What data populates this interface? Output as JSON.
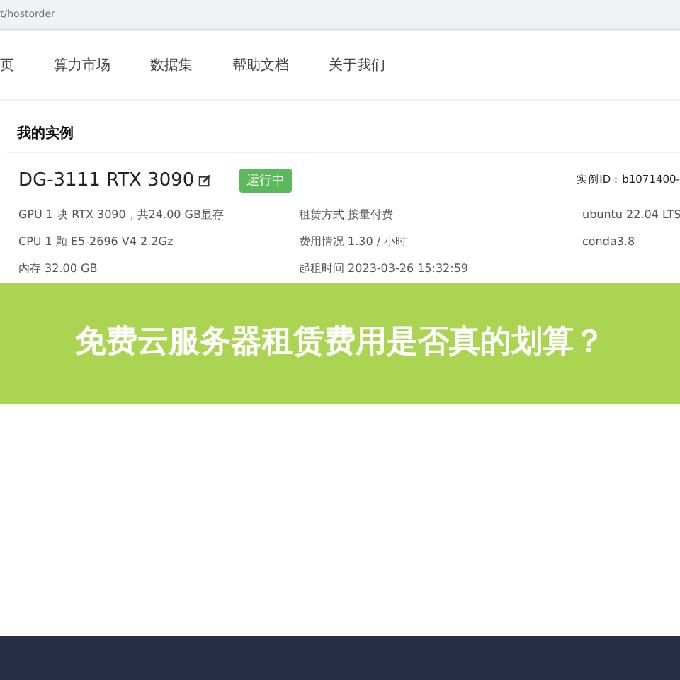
{
  "address_bar": {
    "url": "t/hostorder"
  },
  "nav": [
    {
      "label": "页"
    },
    {
      "label": "算力市场"
    },
    {
      "label": "数据集"
    },
    {
      "label": "帮助文档"
    },
    {
      "label": "关于我们"
    }
  ],
  "section_title": "我的实例",
  "instance": {
    "name": "DG-3111 RTX 3090",
    "status": "运行中",
    "id": "实例ID：b1071400-",
    "rows": [
      [
        "GPU 1 块 RTX 3090，共24.00 GB显存",
        "租赁方式 按量付费",
        "ubuntu 22.04 LTS"
      ],
      [
        "CPU 1 颗 E5-2696 V4 2.2Gz",
        "费用情况 1.30 / 小时",
        "conda3.8"
      ],
      [
        "内存 32.00 GB",
        "起租时间 2023-03-26 15:32:59",
        ""
      ]
    ]
  },
  "banner": {
    "title": "免费云服务器租赁费用是否真的划算？"
  }
}
